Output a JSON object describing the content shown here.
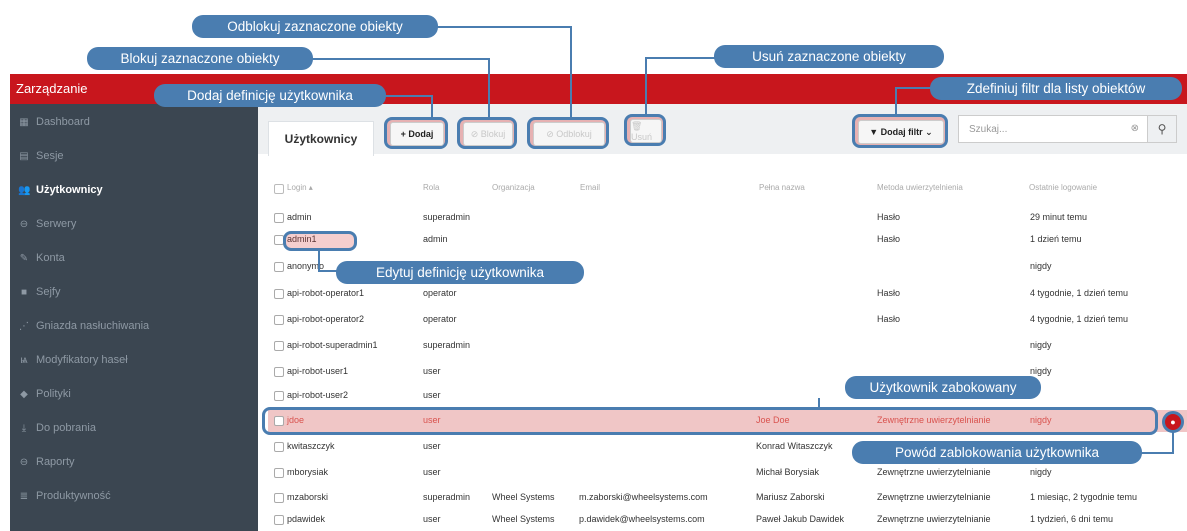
{
  "app": {
    "brand": "Zarządzanie"
  },
  "sidebar": {
    "items": [
      {
        "label": "Dashboard",
        "icon": "dashboard-icon"
      },
      {
        "label": "Sesje",
        "icon": "sessions-icon"
      },
      {
        "label": "Użytkownicy",
        "icon": "users-icon",
        "active": true
      },
      {
        "label": "Serwery",
        "icon": "server-icon"
      },
      {
        "label": "Konta",
        "icon": "account-icon"
      },
      {
        "label": "Sejfy",
        "icon": "safe-icon"
      },
      {
        "label": "Gniazda nasłuchiwania",
        "icon": "listener-icon"
      },
      {
        "label": "Modyfikatory haseł",
        "icon": "password-modifier-icon"
      },
      {
        "label": "Polityki",
        "icon": "policy-icon"
      },
      {
        "label": "Do pobrania",
        "icon": "download-icon"
      },
      {
        "label": "Raporty",
        "icon": "reports-icon"
      },
      {
        "label": "Produktywność",
        "icon": "productivity-icon"
      }
    ]
  },
  "tab": {
    "label": "Użytkownicy"
  },
  "toolbar": {
    "add": "+ Dodaj",
    "block": "⊘ Blokuj",
    "unblock": "⊘ Odblokuj",
    "delete": "🗑 Usuń",
    "filter": "▼ Dodaj filtr ⌄",
    "search_placeholder": "Szukaj..."
  },
  "table": {
    "headers": [
      "Login ▴",
      "Rola",
      "Organizacja",
      "Email",
      "Pełna nazwa",
      "Metoda uwierzytelnienia",
      "Ostatnie logowanie"
    ],
    "rows": [
      [
        "admin",
        "superadmin",
        "",
        "",
        "",
        "Hasło",
        "29 minut temu"
      ],
      [
        "admin1",
        "admin",
        "",
        "",
        "",
        "Hasło",
        "1 dzień temu"
      ],
      [
        "anonymo",
        "",
        "",
        "",
        "",
        "",
        "nigdy"
      ],
      [
        "api-robot-operator1",
        "operator",
        "",
        "",
        "",
        "Hasło",
        "4 tygodnie, 1 dzień temu"
      ],
      [
        "api-robot-operator2",
        "operator",
        "",
        "",
        "",
        "Hasło",
        "4 tygodnie, 1 dzień temu"
      ],
      [
        "api-robot-superadmin1",
        "superadmin",
        "",
        "",
        "",
        "",
        "nigdy"
      ],
      [
        "api-robot-user1",
        "user",
        "",
        "",
        "",
        "",
        "nigdy"
      ],
      [
        "api-robot-user2",
        "user",
        "",
        "",
        "",
        "",
        ""
      ],
      [
        "jdoe",
        "user",
        "",
        "",
        "Joe Doe",
        "Zewnętrzne uwierzytelnianie",
        "nigdy"
      ],
      [
        "kwitaszczyk",
        "user",
        "",
        "",
        "Konrad Witaszczyk",
        "",
        ""
      ],
      [
        "mborysiak",
        "user",
        "",
        "",
        "Michał Borysiak",
        "Zewnętrzne uwierzytelnianie",
        "nigdy"
      ],
      [
        "mzaborski",
        "superadmin",
        "Wheel Systems",
        "m.zaborski@wheelsystems.com",
        "Mariusz Zaborski",
        "Zewnętrzne uwierzytelnianie",
        "1 miesiąc, 2 tygodnie temu"
      ],
      [
        "pdawidek",
        "user",
        "Wheel Systems",
        "p.dawidek@wheelsystems.com",
        "Paweł Jakub Dawidek",
        "Zewnętrzne uwierzytelnianie",
        "1 tydzień, 6 dni temu"
      ]
    ]
  },
  "callouts": {
    "unblock": "Odblokuj zaznaczone obiekty",
    "block": "Blokuj zaznaczone obiekty",
    "delete": "Usuń zaznaczone obiekty",
    "add": "Dodaj definicję użytkownika",
    "filter": "Zdefiniuj filtr dla listy obiektów",
    "edit": "Edytuj definicję użytkownika",
    "blocked_user": "Użytkownik zabokowany",
    "block_reason": "Powód zablokowania użytkownika"
  },
  "colors": {
    "brand_red": "#c8161d",
    "sidebar_bg": "#3b4651",
    "callout_blue": "#4a7db0",
    "blocked_row": "#f0c6c6"
  }
}
